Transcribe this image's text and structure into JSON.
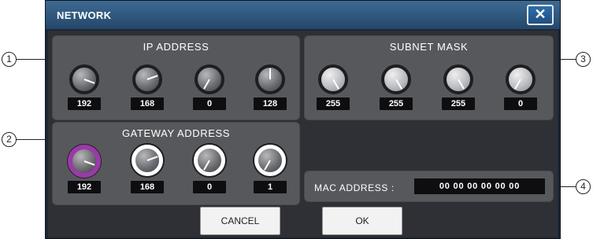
{
  "dialog": {
    "title": "NETWORK",
    "close_label": "✕"
  },
  "ip_address": {
    "title": "IP ADDRESS",
    "octets": [
      "192",
      "168",
      "0",
      "128"
    ]
  },
  "subnet_mask": {
    "title": "SUBNET MASK",
    "octets": [
      "255",
      "255",
      "255",
      "0"
    ]
  },
  "gateway_address": {
    "title": "GATEWAY ADDRESS",
    "octets": [
      "192",
      "168",
      "0",
      "1"
    ]
  },
  "mac_address": {
    "label": "MAC ADDRESS :",
    "value": "00 00 00 00 00 00"
  },
  "buttons": {
    "cancel": "CANCEL",
    "ok": "OK"
  },
  "callouts": [
    "1",
    "2",
    "3",
    "4"
  ],
  "colors": {
    "title_bar": "#2f5a80",
    "panel": "#57585c",
    "selected_ring": "#9b39a8",
    "value_box": "#0e0e10"
  }
}
